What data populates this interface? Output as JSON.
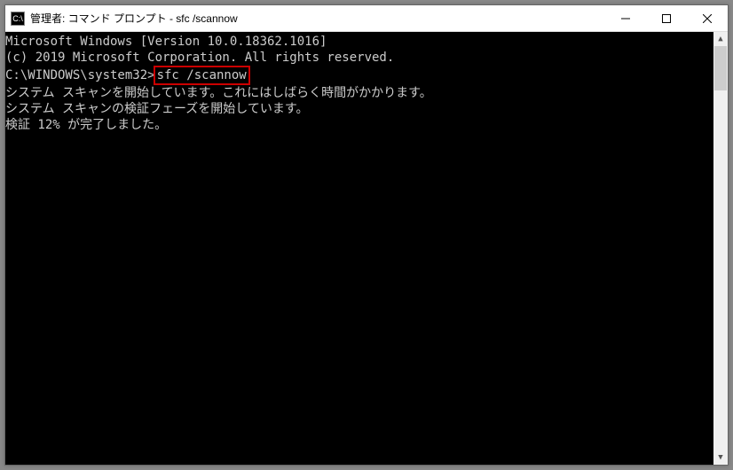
{
  "titlebar": {
    "icon_label": "C:\\",
    "title": "管理者: コマンド プロンプト - sfc  /scannow"
  },
  "console": {
    "line1": "Microsoft Windows [Version 10.0.18362.1016]",
    "line2": "(c) 2019 Microsoft Corporation. All rights reserved.",
    "blank1": "",
    "prompt": "C:\\WINDOWS\\system32>",
    "command": "sfc /scannow",
    "blank2": "",
    "line3": "システム スキャンを開始しています。これにはしばらく時間がかかります。",
    "blank3": "",
    "line4": "システム スキャンの検証フェーズを開始しています。",
    "line5": "検証 12% が完了しました。"
  }
}
